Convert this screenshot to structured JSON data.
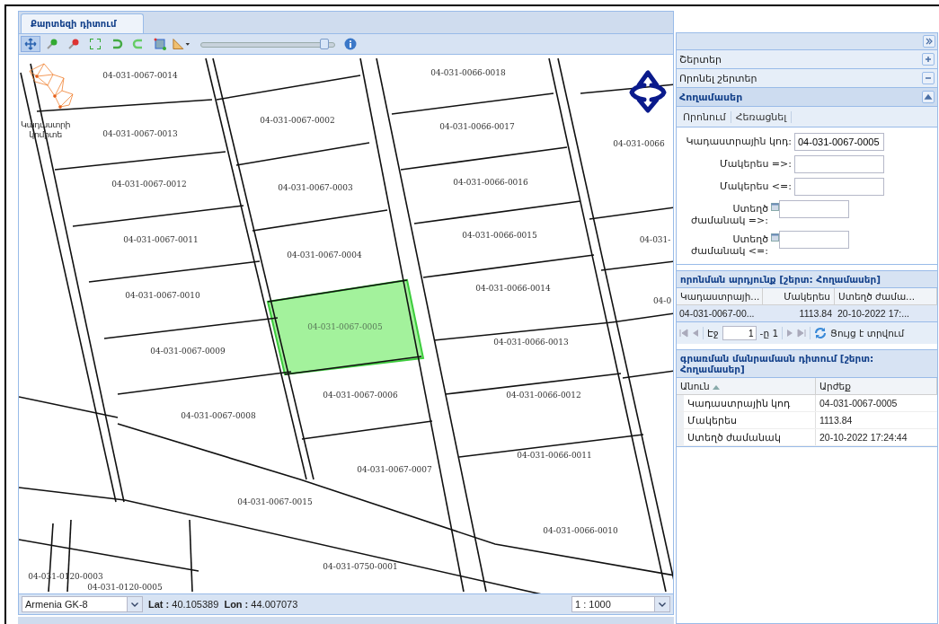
{
  "tabs": [
    {
      "label": "Քարտեզի դիտում",
      "selected": true
    }
  ],
  "toolbar": {
    "tools": [
      {
        "kind": "pan",
        "selected": true
      },
      {
        "kind": "zoom-in",
        "selected": false
      },
      {
        "kind": "zoom-out",
        "selected": false
      },
      {
        "kind": "extent",
        "selected": false
      },
      {
        "kind": "back",
        "selected": false
      },
      {
        "kind": "forward",
        "selected": false
      },
      {
        "kind": "select",
        "selected": false
      },
      {
        "kind": "measure",
        "selected": false
      }
    ],
    "zoom_slider": {
      "level": 0.95
    }
  },
  "map": {
    "logo": [
      "Կադաստրի",
      "կոմիտե"
    ],
    "parcels": [
      {
        "label": "04-031-0067-0014",
        "selected": false
      },
      {
        "label": "04-031-0066-0018",
        "selected": false
      },
      {
        "label": "04-031-0067-0013",
        "selected": false
      },
      {
        "label": "04-031-0067-0002",
        "selected": false
      },
      {
        "label": "04-031-0066-0017",
        "selected": false
      },
      {
        "label": "04-031-0066",
        "selected": false
      },
      {
        "label": "04-031-0067-0012",
        "selected": false
      },
      {
        "label": "04-031-0067-0003",
        "selected": false
      },
      {
        "label": "04-031-0066-0016",
        "selected": false
      },
      {
        "label": "04-031-0067-0011",
        "selected": false
      },
      {
        "label": "04-031-0066-0015",
        "selected": false
      },
      {
        "label": "04-031-",
        "selected": false
      },
      {
        "label": "04-031-0067-0004",
        "selected": false
      },
      {
        "label": "04-031-0067-0010",
        "selected": false
      },
      {
        "label": "04-031-0066-0014",
        "selected": false
      },
      {
        "label": "04-0",
        "selected": false
      },
      {
        "label": "04-031-0067-0005",
        "selected": true
      },
      {
        "label": "04-031-0066-0013",
        "selected": false
      },
      {
        "label": "04-031-0067-0009",
        "selected": false
      },
      {
        "label": "04-031-0067-0006",
        "selected": false
      },
      {
        "label": "04-031-0066-0012",
        "selected": false
      },
      {
        "label": "04-031-0067-0008",
        "selected": false
      },
      {
        "label": "04-031-0066-0011",
        "selected": false
      },
      {
        "label": "04-031-0067-0007",
        "selected": false
      },
      {
        "label": "04-031-0067-0015",
        "selected": false
      },
      {
        "label": "04-031-0066-0010",
        "selected": false
      },
      {
        "label": "04-031-0750-0001",
        "selected": false
      },
      {
        "label": "04-031-0120-0003",
        "selected": false
      },
      {
        "label": "04-031-0120-0005",
        "selected": false
      }
    ]
  },
  "status_bar": {
    "projection": "Armenia GK-8",
    "lat_label": "Lat :",
    "lat": "40.105389",
    "lon_label": "Lon :",
    "lon": "44.007073",
    "scale": "1 : 1000"
  },
  "side_panel": {
    "sections": [
      {
        "title": "Շերտեր",
        "kind": "collapsed"
      },
      {
        "title": "Որոնել շերտեր",
        "kind": "expanded"
      },
      {
        "title": "Հողամասեր",
        "kind": "active"
      }
    ],
    "actions": [
      "Որոնում",
      "Հեռացնել"
    ],
    "form": [
      {
        "label": "Կադաստրային կոդ:",
        "value": "04-031-0067-0005",
        "kind": "text"
      },
      {
        "label": "Մակերես =>:",
        "kind": "text"
      },
      {
        "label": "Մակերես <=:",
        "kind": "text"
      },
      {
        "label": "Ստեղծ ժամանակ =>:",
        "kind": "date"
      },
      {
        "label": "Ստեղծ ժամանակ <=:",
        "kind": "date"
      }
    ],
    "results": {
      "title": "որոնման արդյունք [շերտ: Հողամասեր]",
      "columns": [
        "Կադաստրայի...",
        "Մակերես",
        "Ստեղծ ժամա..."
      ],
      "rows": [
        {
          "cells": [
            "04-031-0067-00...",
            "1113.84",
            "20-10-2022 17:..."
          ],
          "selected": true
        }
      ],
      "pager": {
        "page_label": "Էջ",
        "page": "1",
        "of": "-ը 1",
        "status": "Ցույց է տրվում"
      }
    },
    "details": {
      "title": "գրառման մանրամասն դիտում [շերտ: Հողամասեր]",
      "columns": [
        "Անուն",
        "Արժեք"
      ],
      "rows": [
        [
          "Կադաստրային կոդ",
          "04-031-0067-0005"
        ],
        [
          "Մակերես",
          "1113.84"
        ],
        [
          "Ստեղծ ժամանակ",
          "20-10-2022 17:24:44"
        ]
      ]
    }
  }
}
